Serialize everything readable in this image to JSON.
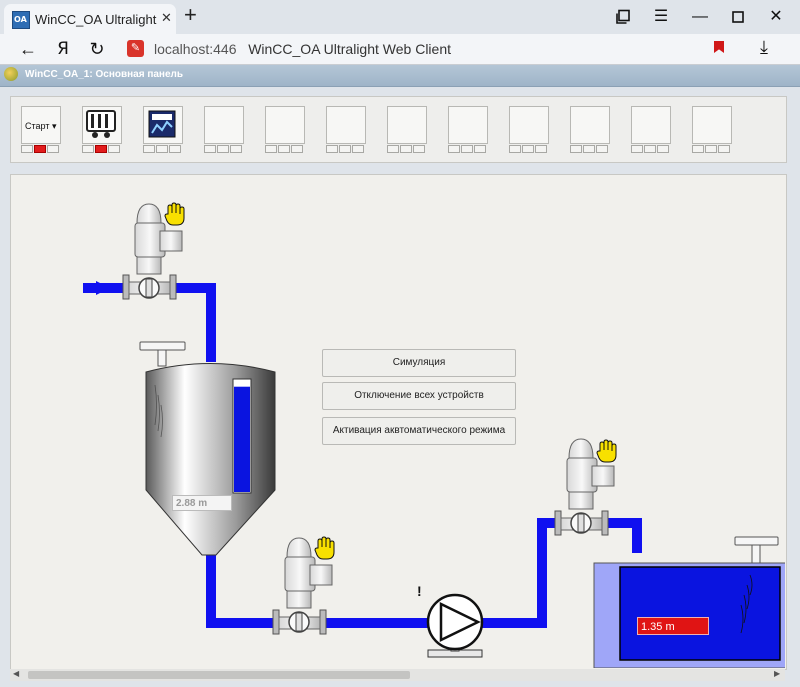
{
  "browser": {
    "tab_title": "WinCC_OA Ultralight Web Client",
    "tab_icon_text": "OA",
    "address_host": "localhost:446",
    "address_page_title": "WinCC_OA Ultralight Web Client"
  },
  "app": {
    "window_title": "WinCC_OA_1: Основная панель"
  },
  "toolbar": {
    "start_label": "Старт ▾",
    "buttons": [
      {
        "name": "start",
        "leds": [
          "off",
          "red",
          "off"
        ]
      },
      {
        "name": "module-1",
        "leds": [
          "off",
          "red",
          "off"
        ]
      },
      {
        "name": "module-2",
        "leds": [
          "off",
          "off",
          "off"
        ]
      },
      {
        "name": "empty-1",
        "leds": [
          "off",
          "off",
          "off"
        ]
      },
      {
        "name": "empty-2",
        "leds": [
          "off",
          "off",
          "off"
        ]
      },
      {
        "name": "empty-3",
        "leds": [
          "off",
          "off",
          "off"
        ]
      },
      {
        "name": "empty-4",
        "leds": [
          "off",
          "off",
          "off"
        ]
      },
      {
        "name": "empty-5",
        "leds": [
          "off",
          "off",
          "off"
        ]
      },
      {
        "name": "empty-6",
        "leds": [
          "off",
          "off",
          "off"
        ]
      },
      {
        "name": "empty-7",
        "leds": [
          "off",
          "off",
          "off"
        ]
      },
      {
        "name": "empty-8",
        "leds": [
          "off",
          "off",
          "off"
        ]
      },
      {
        "name": "empty-9",
        "leds": [
          "off",
          "off",
          "off"
        ]
      },
      {
        "name": "empty-10",
        "leds": [
          "off",
          "off",
          "off"
        ]
      }
    ]
  },
  "controls": {
    "simulation": "Симуляция",
    "disable_all": "Отключение всех устройств",
    "auto_mode": "Активация аквтоматического режима"
  },
  "process": {
    "tank1_level": "2.88 m",
    "tank1_fill_fraction": 0.94,
    "tank2_level": "1.35 m",
    "pump_alert": "!"
  },
  "colors": {
    "pipe": "#1010f0",
    "liquid": "#0a14e0",
    "alarm_red": "#e01010",
    "manual_hand": "#f8e000"
  },
  "icons": {
    "back": "back-arrow-icon",
    "yandex": "yandex-icon",
    "refresh": "refresh-icon",
    "manual": "hand-icon"
  }
}
